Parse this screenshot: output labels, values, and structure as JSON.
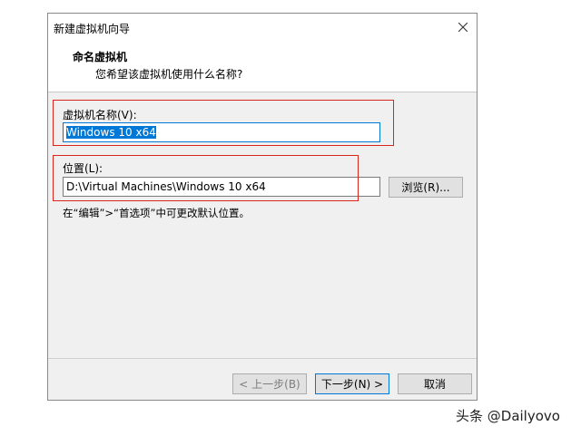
{
  "window": {
    "title": "新建虚拟机向导"
  },
  "header": {
    "title": "命名虚拟机",
    "subtitle": "您希望该虚拟机使用什么名称?"
  },
  "name_section": {
    "label": "虚拟机名称(V):",
    "value": "Windows 10 x64"
  },
  "location_section": {
    "label": "位置(L):",
    "value": "D:\\Virtual Machines\\Windows 10 x64",
    "browse_label": "浏览(R)..."
  },
  "hint": "在“编辑”>“首选项”中可更改默认位置。",
  "footer": {
    "back_label": "< 上一步(B)",
    "next_label": "下一步(N) >",
    "cancel_label": "取消"
  },
  "watermark": "头条 @Dailyovo",
  "colors": {
    "highlight_box": "#d9261c",
    "selection": "#0078d7"
  }
}
